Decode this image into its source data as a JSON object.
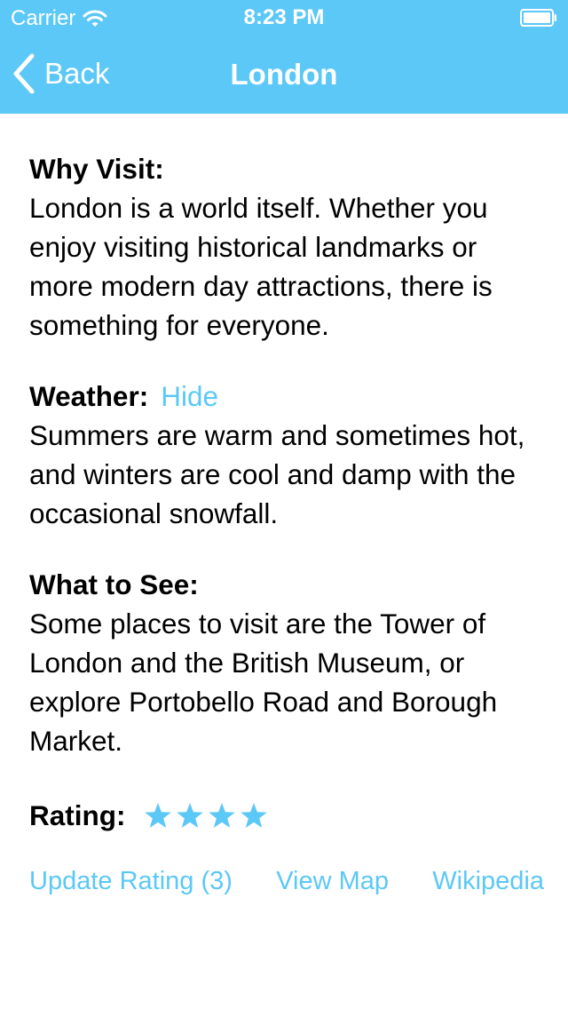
{
  "status_bar": {
    "carrier": "Carrier",
    "time": "8:23 PM"
  },
  "nav": {
    "back_label": "Back",
    "title": "London"
  },
  "colors": {
    "accent": "#5bc8f7",
    "text": "#000000",
    "header_text": "#ffffff"
  },
  "sections": {
    "why_visit": {
      "label": "Why Visit:",
      "text": "London is a world itself. Whether you enjoy visiting historical landmarks or more modern day attractions, there is something for everyone."
    },
    "weather": {
      "label": "Weather:",
      "action_label": "Hide",
      "text": "Summers are warm and sometimes hot, and winters are cool and damp with the occasional snowfall."
    },
    "what_to_see": {
      "label": "What to See:",
      "text": "Some places to visit are the Tower of London and the British Museum, or explore Portobello Road and Borough Market."
    }
  },
  "rating": {
    "label": "Rating:",
    "stars": 4,
    "star_glyph": "★"
  },
  "actions": {
    "update_rating": "Update Rating (3)",
    "view_map": "View Map",
    "wikipedia": "Wikipedia"
  },
  "icons": [
    "wifi-icon",
    "battery-icon",
    "chevron-left-icon",
    "star-icon"
  ]
}
